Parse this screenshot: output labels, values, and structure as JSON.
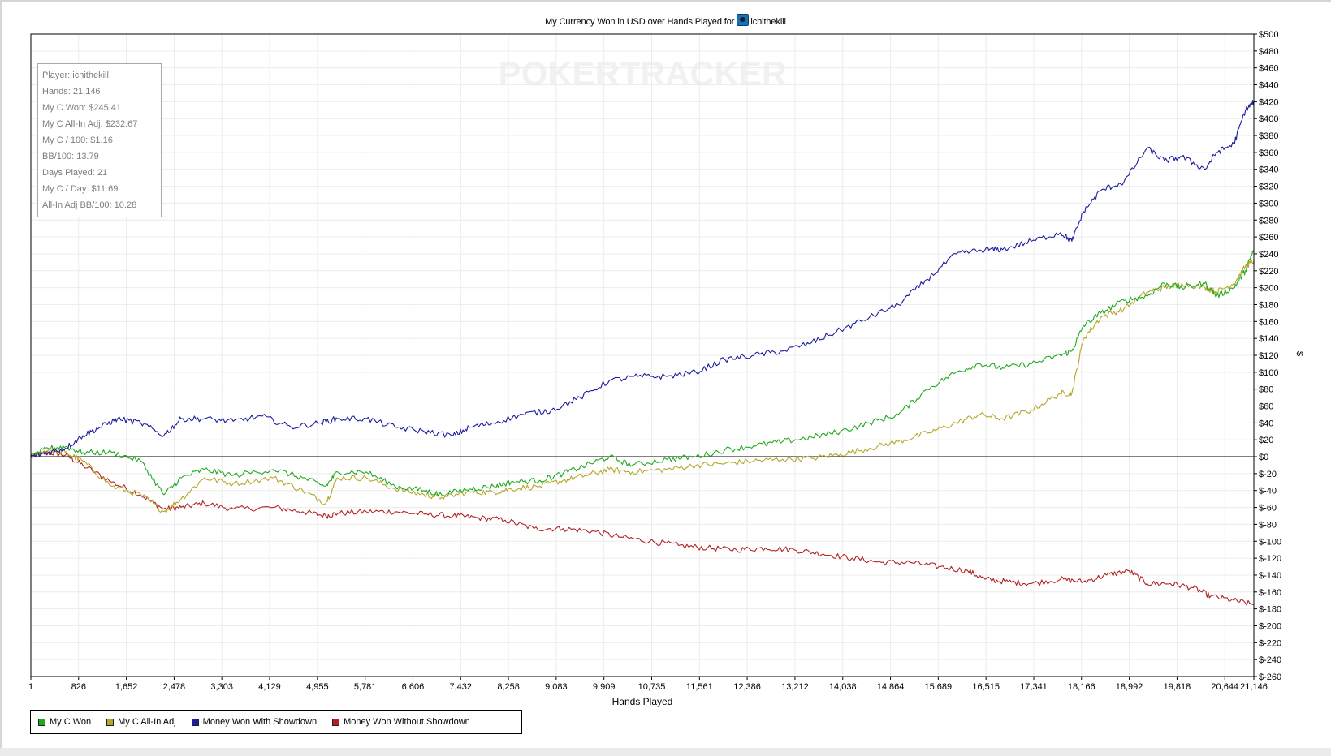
{
  "chart_data": {
    "type": "line",
    "title": "My Currency Won in USD over Hands Played for",
    "player_name": "ichithekill",
    "player_icon": "player-site-icon",
    "xlabel": "Hands Played",
    "ylabel": "$",
    "xlim": [
      1,
      21146
    ],
    "ylim": [
      -260,
      500
    ],
    "x_ticks": [
      "1",
      "826",
      "1,652",
      "2,478",
      "3,303",
      "4,129",
      "4,955",
      "5,781",
      "6,606",
      "7,432",
      "8,258",
      "9,083",
      "9,909",
      "10,735",
      "11,561",
      "12,386",
      "13,212",
      "14,038",
      "14,864",
      "15,689",
      "16,515",
      "17,341",
      "18,166",
      "18,992",
      "19,818",
      "20,644",
      "21,146"
    ],
    "y_ticks": [
      "$500",
      "$480",
      "$460",
      "$440",
      "$420",
      "$400",
      "$380",
      "$360",
      "$340",
      "$320",
      "$300",
      "$280",
      "$260",
      "$240",
      "$220",
      "$200",
      "$180",
      "$160",
      "$140",
      "$120",
      "$100",
      "$80",
      "$60",
      "$40",
      "$20",
      "$0",
      "$-20",
      "$-40",
      "$-60",
      "$-80",
      "$-100",
      "$-120",
      "$-140",
      "$-160",
      "$-180",
      "$-200",
      "$-220",
      "$-240",
      "$-260"
    ],
    "grid": true,
    "legend_position": "bottom-left",
    "watermark": "POKERTRACKER",
    "series": [
      {
        "name": "My C Won",
        "color": "#1faa1f",
        "points": [
          [
            1,
            0
          ],
          [
            300,
            10
          ],
          [
            600,
            12
          ],
          [
            900,
            5
          ],
          [
            1400,
            5
          ],
          [
            1900,
            -5
          ],
          [
            2300,
            -45
          ],
          [
            2600,
            -25
          ],
          [
            3000,
            -15
          ],
          [
            3500,
            -22
          ],
          [
            4200,
            -15
          ],
          [
            4700,
            -25
          ],
          [
            5100,
            -35
          ],
          [
            5300,
            -18
          ],
          [
            5800,
            -18
          ],
          [
            6300,
            -35
          ],
          [
            6800,
            -40
          ],
          [
            7100,
            -45
          ],
          [
            7600,
            -38
          ],
          [
            8000,
            -35
          ],
          [
            8300,
            -30
          ],
          [
            8800,
            -28
          ],
          [
            9200,
            -20
          ],
          [
            9600,
            -10
          ],
          [
            10000,
            0
          ],
          [
            10400,
            -10
          ],
          [
            11000,
            -3
          ],
          [
            11500,
            0
          ],
          [
            12000,
            8
          ],
          [
            12500,
            13
          ],
          [
            13000,
            18
          ],
          [
            13500,
            23
          ],
          [
            14000,
            30
          ],
          [
            14500,
            40
          ],
          [
            15000,
            50
          ],
          [
            15500,
            80
          ],
          [
            16000,
            100
          ],
          [
            16400,
            110
          ],
          [
            16800,
            105
          ],
          [
            17300,
            110
          ],
          [
            17800,
            120
          ],
          [
            18000,
            125
          ],
          [
            18200,
            155
          ],
          [
            18500,
            170
          ],
          [
            18900,
            185
          ],
          [
            19300,
            190
          ],
          [
            19600,
            205
          ],
          [
            19900,
            200
          ],
          [
            20300,
            205
          ],
          [
            20500,
            190
          ],
          [
            20800,
            200
          ],
          [
            21000,
            220
          ],
          [
            21146,
            245
          ]
        ]
      },
      {
        "name": "My C All-In Adj",
        "color": "#b5a628",
        "points": [
          [
            1,
            0
          ],
          [
            300,
            8
          ],
          [
            600,
            5
          ],
          [
            900,
            -5
          ],
          [
            1400,
            -35
          ],
          [
            1900,
            -45
          ],
          [
            2300,
            -65
          ],
          [
            2600,
            -50
          ],
          [
            3000,
            -25
          ],
          [
            3500,
            -32
          ],
          [
            4200,
            -25
          ],
          [
            4700,
            -40
          ],
          [
            5100,
            -55
          ],
          [
            5300,
            -25
          ],
          [
            5800,
            -25
          ],
          [
            6300,
            -38
          ],
          [
            6800,
            -45
          ],
          [
            7100,
            -48
          ],
          [
            7600,
            -42
          ],
          [
            8000,
            -42
          ],
          [
            8300,
            -38
          ],
          [
            8800,
            -35
          ],
          [
            9200,
            -28
          ],
          [
            9600,
            -22
          ],
          [
            10000,
            -15
          ],
          [
            10400,
            -18
          ],
          [
            11000,
            -15
          ],
          [
            11500,
            -10
          ],
          [
            12000,
            -8
          ],
          [
            12500,
            -5
          ],
          [
            13000,
            -3
          ],
          [
            13500,
            -2
          ],
          [
            14000,
            3
          ],
          [
            14500,
            10
          ],
          [
            15000,
            18
          ],
          [
            15500,
            28
          ],
          [
            16000,
            40
          ],
          [
            16400,
            50
          ],
          [
            16800,
            45
          ],
          [
            17300,
            55
          ],
          [
            17800,
            75
          ],
          [
            18000,
            75
          ],
          [
            18200,
            140
          ],
          [
            18500,
            165
          ],
          [
            18900,
            175
          ],
          [
            19300,
            195
          ],
          [
            19600,
            200
          ],
          [
            19900,
            205
          ],
          [
            20300,
            200
          ],
          [
            20500,
            195
          ],
          [
            20800,
            205
          ],
          [
            21000,
            225
          ],
          [
            21146,
            232
          ]
        ]
      },
      {
        "name": "Money Won With Showdown",
        "color": "#1c1ca0",
        "points": [
          [
            1,
            0
          ],
          [
            300,
            5
          ],
          [
            600,
            10
          ],
          [
            900,
            25
          ],
          [
            1200,
            35
          ],
          [
            1500,
            45
          ],
          [
            1900,
            40
          ],
          [
            2300,
            25
          ],
          [
            2600,
            45
          ],
          [
            3000,
            45
          ],
          [
            3500,
            42
          ],
          [
            4000,
            48
          ],
          [
            4500,
            35
          ],
          [
            5000,
            40
          ],
          [
            5300,
            45
          ],
          [
            5800,
            45
          ],
          [
            6300,
            35
          ],
          [
            6800,
            30
          ],
          [
            7300,
            25
          ],
          [
            7600,
            35
          ],
          [
            8000,
            40
          ],
          [
            8500,
            50
          ],
          [
            9000,
            55
          ],
          [
            9500,
            70
          ],
          [
            10000,
            90
          ],
          [
            10500,
            95
          ],
          [
            11000,
            95
          ],
          [
            11500,
            100
          ],
          [
            12000,
            115
          ],
          [
            12500,
            120
          ],
          [
            13000,
            125
          ],
          [
            13500,
            135
          ],
          [
            14000,
            150
          ],
          [
            14500,
            165
          ],
          [
            15000,
            180
          ],
          [
            15500,
            210
          ],
          [
            16000,
            240
          ],
          [
            16500,
            245
          ],
          [
            16800,
            245
          ],
          [
            17300,
            255
          ],
          [
            17800,
            265
          ],
          [
            18000,
            255
          ],
          [
            18200,
            290
          ],
          [
            18500,
            315
          ],
          [
            18900,
            325
          ],
          [
            19300,
            365
          ],
          [
            19600,
            350
          ],
          [
            19900,
            355
          ],
          [
            20300,
            340
          ],
          [
            20500,
            360
          ],
          [
            20800,
            370
          ],
          [
            21000,
            410
          ],
          [
            21146,
            420
          ]
        ]
      },
      {
        "name": "Money Won Without Showdown",
        "color": "#b22222",
        "points": [
          [
            1,
            0
          ],
          [
            300,
            5
          ],
          [
            600,
            2
          ],
          [
            900,
            -10
          ],
          [
            1400,
            -30
          ],
          [
            1900,
            -45
          ],
          [
            2300,
            -62
          ],
          [
            2600,
            -60
          ],
          [
            3000,
            -55
          ],
          [
            3500,
            -62
          ],
          [
            4200,
            -60
          ],
          [
            4700,
            -65
          ],
          [
            5100,
            -70
          ],
          [
            5300,
            -67
          ],
          [
            5800,
            -65
          ],
          [
            6300,
            -65
          ],
          [
            6800,
            -68
          ],
          [
            7300,
            -70
          ],
          [
            7700,
            -72
          ],
          [
            8200,
            -75
          ],
          [
            8700,
            -85
          ],
          [
            9200,
            -85
          ],
          [
            9700,
            -88
          ],
          [
            10200,
            -95
          ],
          [
            10700,
            -100
          ],
          [
            11200,
            -105
          ],
          [
            11700,
            -108
          ],
          [
            12200,
            -110
          ],
          [
            12700,
            -108
          ],
          [
            13200,
            -110
          ],
          [
            13700,
            -115
          ],
          [
            14200,
            -120
          ],
          [
            14700,
            -125
          ],
          [
            15200,
            -125
          ],
          [
            15700,
            -130
          ],
          [
            16200,
            -135
          ],
          [
            16500,
            -145
          ],
          [
            16900,
            -148
          ],
          [
            17300,
            -150
          ],
          [
            17800,
            -145
          ],
          [
            18200,
            -148
          ],
          [
            18600,
            -140
          ],
          [
            18992,
            -135
          ],
          [
            19300,
            -150
          ],
          [
            19700,
            -150
          ],
          [
            20100,
            -155
          ],
          [
            20400,
            -165
          ],
          [
            20800,
            -170
          ],
          [
            21146,
            -175
          ]
        ]
      }
    ]
  },
  "stats": {
    "player": "Player: ichithekill",
    "hands": "Hands: 21,146",
    "won": "My C Won: $245.41",
    "allin_adj": "My C All-In Adj: $232.67",
    "per100": "My C / 100: $1.16",
    "bb100": "BB/100: 13.79",
    "days": "Days Played: 21",
    "per_day": "My C / Day: $11.69",
    "allin_bb100": "All-In Adj BB/100: 10.28"
  }
}
